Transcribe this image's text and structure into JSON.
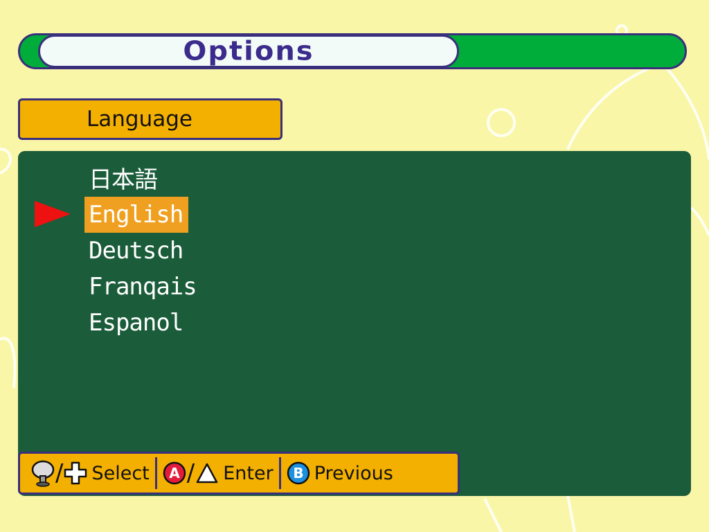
{
  "title": "Options",
  "section": "Language",
  "languages": {
    "items": [
      "日本語",
      "English",
      "Deutsch",
      "Franqais",
      "Espanol"
    ],
    "selected_index": 1
  },
  "controls": {
    "select_label": "Select",
    "enter_label": "Enter",
    "previous_label": "Previous",
    "a_button_letter": "A",
    "b_button_letter": "B"
  },
  "colors": {
    "background": "#faf6a8",
    "title_bar": "#00ad3a",
    "panel": "#1b5c3a",
    "highlight": "#f0a020",
    "label_bar": "#f4b000",
    "cursor": "#ee1111",
    "a_button": "#e41c3c",
    "b_button": "#1e90e0"
  },
  "icons": [
    "stick-icon",
    "dpad-icon",
    "a-button-icon",
    "triangle-icon",
    "b-button-icon",
    "cursor-arrow-icon"
  ]
}
